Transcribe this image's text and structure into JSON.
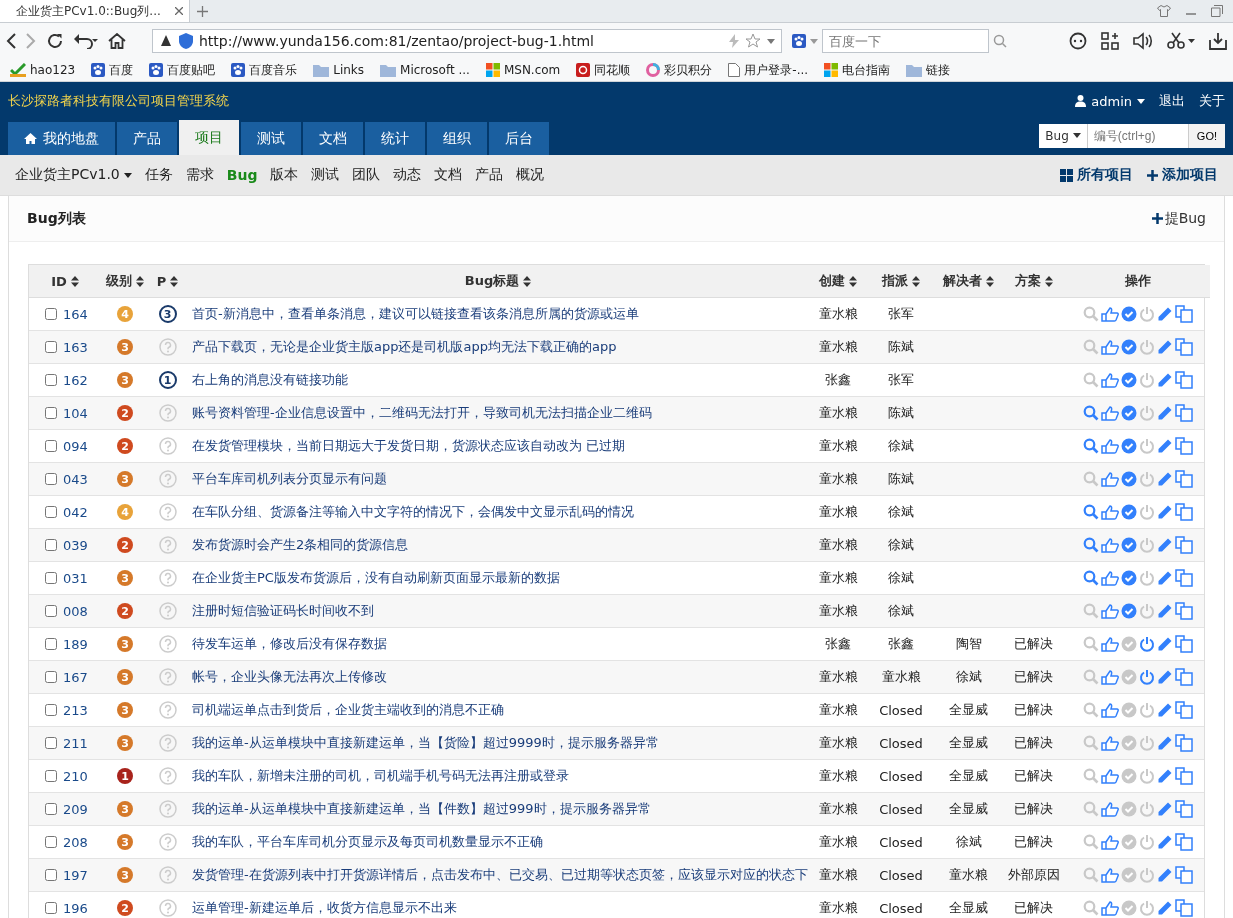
{
  "browser": {
    "tab_title": "企业货主PCv1.0::Bug列...",
    "url": "http://www.yunda156.com:81/zentao/project-bug-1.html",
    "search_placeholder": "百度一下",
    "bookmarks": [
      {
        "label": "hao123",
        "kind": "check"
      },
      {
        "label": "百度",
        "kind": "paw"
      },
      {
        "label": "百度贴吧",
        "kind": "paw"
      },
      {
        "label": "百度音乐",
        "kind": "paw"
      },
      {
        "label": "Links",
        "kind": "folder"
      },
      {
        "label": "Microsoft ...",
        "kind": "folder"
      },
      {
        "label": "MSN.com",
        "kind": "tiles"
      },
      {
        "label": "同花顺",
        "kind": "red"
      },
      {
        "label": "彩贝积分",
        "kind": "ring"
      },
      {
        "label": "用户登录-...",
        "kind": "page"
      },
      {
        "label": "电台指南",
        "kind": "tiles"
      },
      {
        "label": "链接",
        "kind": "folder"
      }
    ]
  },
  "header": {
    "title": "长沙探路者科技有限公司项目管理系统",
    "user": "admin",
    "logout": "退出",
    "about": "关于",
    "tabs": [
      {
        "label": "我的地盘",
        "selected": false
      },
      {
        "label": "产品",
        "selected": false
      },
      {
        "label": "项目",
        "selected": true
      },
      {
        "label": "测试",
        "selected": false
      },
      {
        "label": "文档",
        "selected": false
      },
      {
        "label": "统计",
        "selected": false
      },
      {
        "label": "组织",
        "selected": false
      },
      {
        "label": "后台",
        "selected": false
      }
    ],
    "search": {
      "type": "Bug",
      "placeholder": "编号(ctrl+g)",
      "button": "GO!"
    }
  },
  "subnav": {
    "project": "企业货主PCv1.0",
    "items": [
      {
        "label": "任务",
        "selected": false
      },
      {
        "label": "需求",
        "selected": false
      },
      {
        "label": "Bug",
        "selected": true
      },
      {
        "label": "版本",
        "selected": false
      },
      {
        "label": "测试",
        "selected": false
      },
      {
        "label": "团队",
        "selected": false
      },
      {
        "label": "动态",
        "selected": false
      },
      {
        "label": "文档",
        "selected": false
      },
      {
        "label": "产品",
        "selected": false
      },
      {
        "label": "概况",
        "selected": false
      }
    ],
    "all_projects": "所有项目",
    "add_project": "添加项目"
  },
  "panel": {
    "title": "Bug列表",
    "new_bug": "提Bug"
  },
  "table": {
    "columns": [
      {
        "label": "ID",
        "sortable": true
      },
      {
        "label": "级别",
        "sortable": true
      },
      {
        "label": "P",
        "sortable": true
      },
      {
        "label": "Bug标题",
        "sortable": true
      },
      {
        "label": "创建",
        "sortable": true
      },
      {
        "label": "指派",
        "sortable": true
      },
      {
        "label": "解决者",
        "sortable": true
      },
      {
        "label": "方案",
        "sortable": true
      },
      {
        "label": "操作",
        "sortable": false
      }
    ],
    "rows": [
      {
        "checked": false,
        "id": "164",
        "severity": {
          "label": "4",
          "color": "#e8a33a"
        },
        "priority": "3",
        "title": "首页-新消息中，查看单条消息，建议可以链接查看该条消息所属的货源或运单",
        "creator": "童水粮",
        "assigned": "张军",
        "view_enabled": false,
        "confirm_enabled": true,
        "close_enabled": false
      },
      {
        "checked": false,
        "id": "163",
        "severity": {
          "label": "3",
          "color": "#d5792a"
        },
        "title": "产品下载页，无论是企业货主版app还是司机版app均无法下载正确的app",
        "creator": "童水粮",
        "assigned": "陈斌",
        "view_enabled": false,
        "confirm_enabled": true,
        "close_enabled": false
      },
      {
        "checked": false,
        "id": "162",
        "severity": {
          "label": "3",
          "color": "#d5792a"
        },
        "priority": "1",
        "title": "右上角的消息没有链接功能",
        "creator": "张鑫",
        "assigned": "张军",
        "view_enabled": false,
        "confirm_enabled": true,
        "close_enabled": false
      },
      {
        "checked": false,
        "id": "104",
        "severity": {
          "label": "2",
          "color": "#cf4a1f"
        },
        "title": "账号资料管理-企业信息设置中，二维码无法打开，导致司机无法扫描企业二维码",
        "creator": "童水粮",
        "assigned": "陈斌",
        "view_enabled": true,
        "confirm_enabled": true,
        "close_enabled": false
      },
      {
        "checked": false,
        "id": "094",
        "severity": {
          "label": "2",
          "color": "#cf4a1f"
        },
        "title": "在发货管理模块，当前日期远大于发货日期，货源状态应该自动改为 已过期",
        "creator": "童水粮",
        "assigned": "徐斌",
        "view_enabled": true,
        "confirm_enabled": true,
        "close_enabled": false
      },
      {
        "checked": false,
        "id": "043",
        "severity": {
          "label": "3",
          "color": "#d5792a"
        },
        "title": "平台车库司机列表分页显示有问题",
        "creator": "童水粮",
        "assigned": "陈斌",
        "view_enabled": false,
        "confirm_enabled": true,
        "close_enabled": false
      },
      {
        "checked": false,
        "id": "042",
        "severity": {
          "label": "4",
          "color": "#e8a33a"
        },
        "title": "在车队分组、货源备注等输入中文字符的情况下，会偶发中文显示乱码的情况",
        "creator": "童水粮",
        "assigned": "徐斌",
        "view_enabled": true,
        "confirm_enabled": true,
        "close_enabled": false
      },
      {
        "checked": false,
        "id": "039",
        "severity": {
          "label": "2",
          "color": "#cf4a1f"
        },
        "title": "发布货源时会产生2条相同的货源信息",
        "creator": "童水粮",
        "assigned": "徐斌",
        "view_enabled": true,
        "confirm_enabled": true,
        "close_enabled": false
      },
      {
        "checked": false,
        "id": "031",
        "severity": {
          "label": "3",
          "color": "#d5792a"
        },
        "title": "在企业货主PC版发布货源后，没有自动刷新页面显示最新的数据",
        "creator": "童水粮",
        "assigned": "徐斌",
        "view_enabled": true,
        "confirm_enabled": true,
        "close_enabled": false
      },
      {
        "checked": false,
        "id": "008",
        "severity": {
          "label": "2",
          "color": "#cf4a1f"
        },
        "title": "注册时短信验证码长时间收不到",
        "creator": "童水粮",
        "assigned": "徐斌",
        "view_enabled": false,
        "confirm_enabled": true,
        "close_enabled": false
      },
      {
        "checked": false,
        "id": "189",
        "severity": {
          "label": "3",
          "color": "#d5792a"
        },
        "title": "待发车运单，修改后没有保存数据",
        "creator": "张鑫",
        "assigned": "张鑫",
        "resolver": "陶智",
        "resolution": "已解决",
        "view_enabled": false,
        "confirm_enabled": false,
        "close_enabled": true
      },
      {
        "checked": false,
        "id": "167",
        "severity": {
          "label": "3",
          "color": "#d5792a"
        },
        "title": "帐号，企业头像无法再次上传修改",
        "creator": "童水粮",
        "assigned": "童水粮",
        "resolver": "徐斌",
        "resolution": "已解决",
        "view_enabled": false,
        "confirm_enabled": false,
        "close_enabled": true
      },
      {
        "checked": false,
        "id": "213",
        "severity": {
          "label": "3",
          "color": "#d5792a"
        },
        "title": "司机端运单点击到货后，企业货主端收到的消息不正确",
        "creator": "童水粮",
        "assigned": "Closed",
        "resolver": "全显威",
        "resolution": "已解决",
        "view_enabled": false,
        "confirm_enabled": false,
        "close_enabled": false
      },
      {
        "checked": false,
        "id": "211",
        "severity": {
          "label": "3",
          "color": "#d5792a"
        },
        "title": "我的运单-从运单模块中直接新建运单，当【货险】超过9999时，提示服务器异常",
        "creator": "童水粮",
        "assigned": "Closed",
        "resolver": "全显威",
        "resolution": "已解决",
        "view_enabled": false,
        "confirm_enabled": false,
        "close_enabled": false
      },
      {
        "checked": false,
        "id": "210",
        "severity": {
          "label": "1",
          "color": "#a8231c"
        },
        "title": "我的车队，新增未注册的司机，司机端手机号码无法再注册或登录",
        "creator": "童水粮",
        "assigned": "Closed",
        "resolver": "全显威",
        "resolution": "已解决",
        "view_enabled": false,
        "confirm_enabled": false,
        "close_enabled": false
      },
      {
        "checked": false,
        "id": "209",
        "severity": {
          "label": "3",
          "color": "#d5792a"
        },
        "title": "我的运单-从运单模块中直接新建运单，当【件数】超过999时，提示服务器异常",
        "creator": "童水粮",
        "assigned": "Closed",
        "resolver": "全显威",
        "resolution": "已解决",
        "view_enabled": false,
        "confirm_enabled": false,
        "close_enabled": false
      },
      {
        "checked": false,
        "id": "208",
        "severity": {
          "label": "3",
          "color": "#d5792a"
        },
        "title": "我的车队，平台车库司机分页显示及每页司机数量显示不正确",
        "creator": "童水粮",
        "assigned": "Closed",
        "resolver": "徐斌",
        "resolution": "已解决",
        "view_enabled": false,
        "confirm_enabled": false,
        "close_enabled": false
      },
      {
        "checked": false,
        "id": "197",
        "severity": {
          "label": "3",
          "color": "#d5792a"
        },
        "title": "发货管理-在货源列表中打开货源详情后，点击发布中、已交易、已过期等状态页签，应该显示对应的状态下",
        "creator": "童水粮",
        "assigned": "Closed",
        "resolver": "童水粮",
        "resolution": "外部原因",
        "view_enabled": false,
        "confirm_enabled": false,
        "close_enabled": false
      },
      {
        "checked": false,
        "id": "196",
        "severity": {
          "label": "2",
          "color": "#cf4a1f"
        },
        "title": "运单管理-新建运单后，收货方信息显示不出来",
        "creator": "童水粮",
        "assigned": "Closed",
        "resolver": "全显威",
        "resolution": "已解决",
        "view_enabled": false,
        "confirm_enabled": false,
        "close_enabled": false
      }
    ]
  }
}
